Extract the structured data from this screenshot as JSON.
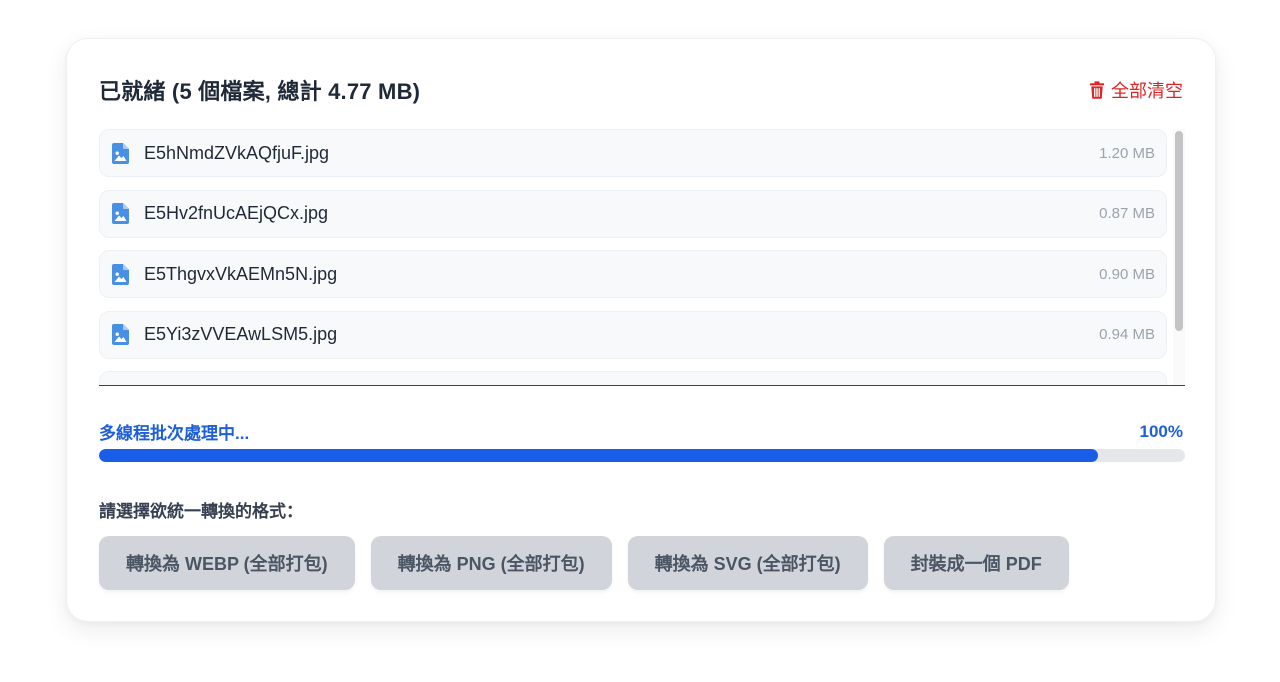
{
  "header": {
    "title": "已就緒 (5 個檔案, 總計 4.77 MB)",
    "clear_all_label": "全部清空"
  },
  "files": [
    {
      "name": "E5hNmdZVkAQfjuF.jpg",
      "size": "1.20 MB"
    },
    {
      "name": "E5Hv2fnUcAEjQCx.jpg",
      "size": "0.87 MB"
    },
    {
      "name": "E5ThgvxVkAEMn5N.jpg",
      "size": "0.90 MB"
    },
    {
      "name": "E5Yi3zVVEAwLSM5.jpg",
      "size": "0.94 MB"
    },
    {
      "name": "",
      "size": ""
    }
  ],
  "progress": {
    "label": "多線程批次處理中...",
    "percent_text": "100%",
    "value": 0.92
  },
  "format_section": {
    "label": "請選擇欲統一轉換的格式：",
    "buttons": [
      "轉換為 WEBP (全部打包)",
      "轉換為 PNG (全部打包)",
      "轉換為 SVG (全部打包)",
      "封裝成一個 PDF"
    ]
  },
  "colors": {
    "accent": "#1a5ee8",
    "danger": "#dc2626",
    "file_icon": "#4a90e2"
  },
  "icons": {
    "file": "image-file-icon",
    "clear": "trash-icon"
  }
}
